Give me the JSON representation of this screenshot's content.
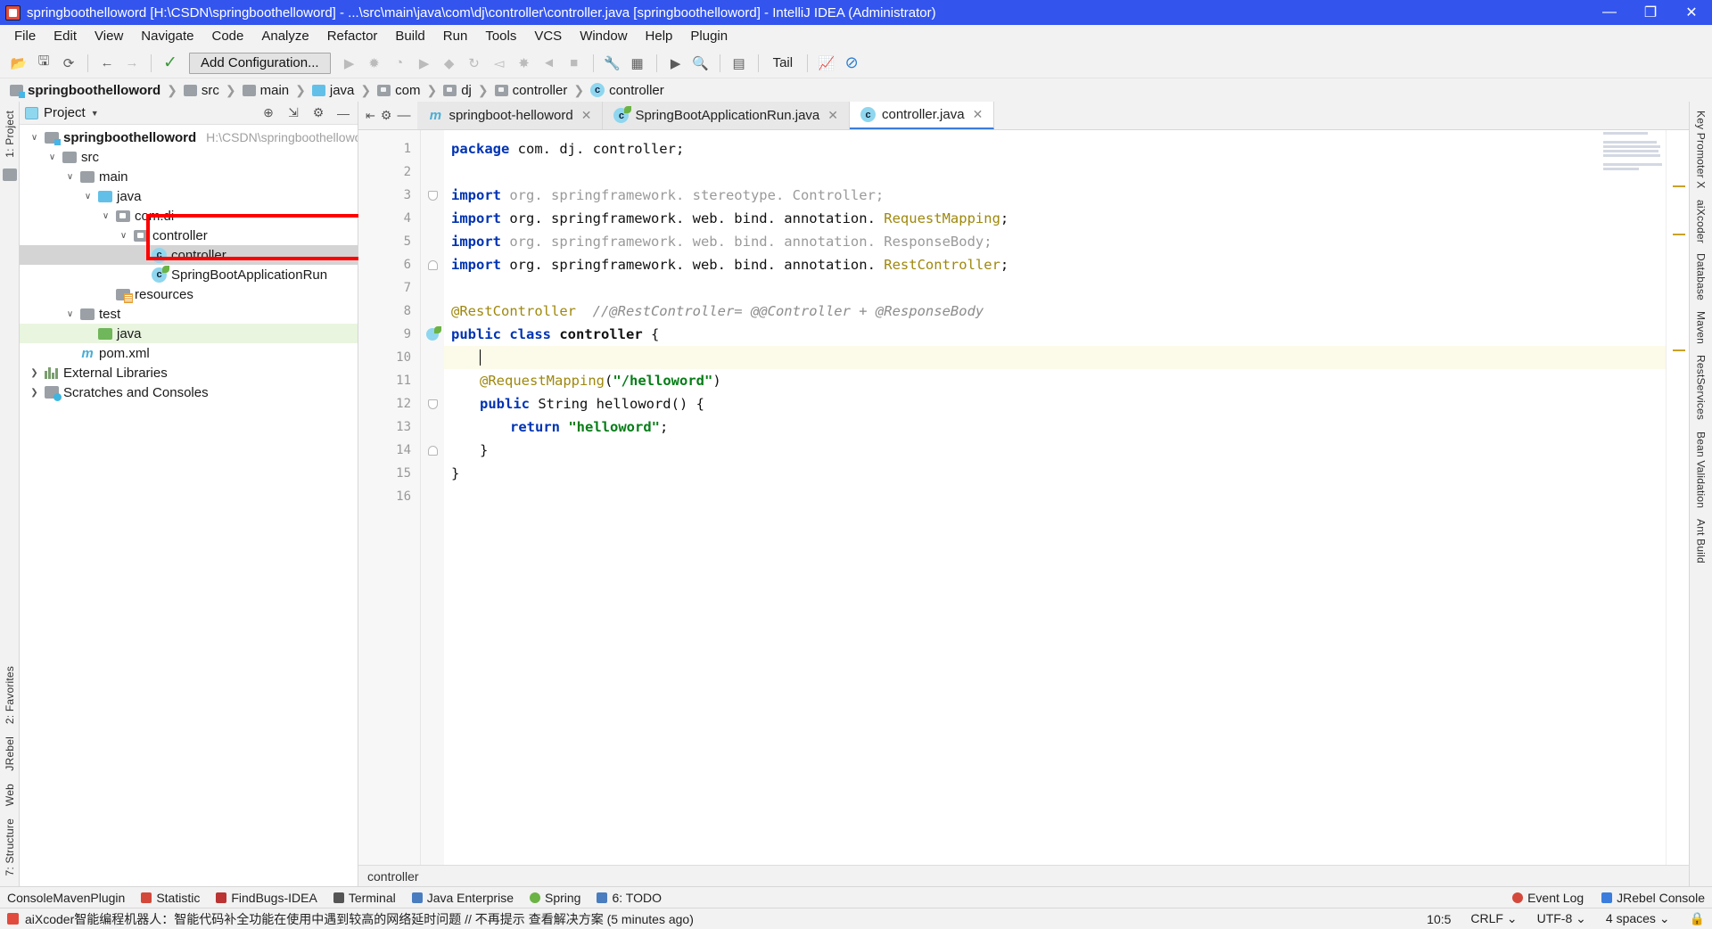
{
  "window": {
    "title": "springboothelloword [H:\\CSDN\\springboothelloword] - ...\\src\\main\\java\\com\\dj\\controller\\controller.java [springboothelloword] - IntelliJ IDEA (Administrator)",
    "minimize": "—",
    "maximize": "❐",
    "close": "✕"
  },
  "menu": [
    "File",
    "Edit",
    "View",
    "Navigate",
    "Code",
    "Analyze",
    "Refactor",
    "Build",
    "Run",
    "Tools",
    "VCS",
    "Window",
    "Help",
    "Plugin"
  ],
  "toolbar": {
    "open_icon": "open-folder-icon",
    "save_icon": "save-icon",
    "sync_icon": "sync-icon",
    "back_icon": "back-arrow-icon",
    "forward_icon": "forward-arrow-icon",
    "hammer_icon": "build-icon",
    "add_configuration": "Add Configuration...",
    "run_icon": "run-icon",
    "debug_icon": "debug-icon",
    "coverage_icon": "coverage-icon",
    "run2_icon": "run-alt-icon",
    "profile_icon": "profile-icon",
    "rerun_icon": "rerun-icon",
    "jrebel_run_icon": "jrebel-run-icon",
    "jrebel_debug_icon": "jrebel-debug-icon",
    "jrebel_icon": "jrebel-icon",
    "stop_icon": "stop-icon",
    "settings_icon": "wrench-icon",
    "project_structure_icon": "project-structure-icon",
    "terminal_icon": "terminal-icon",
    "search_icon": "search-icon",
    "db_icon": "database-save-icon",
    "tail_label": "Tail",
    "monitor_icon": "monitor-icon",
    "block_icon": "block-icon"
  },
  "breadcrumb": [
    {
      "label": "springboothelloword",
      "icon": "module-folder-icon",
      "bold": true
    },
    {
      "label": "src",
      "icon": "folder-icon",
      "bold": false
    },
    {
      "label": "main",
      "icon": "folder-icon",
      "bold": false
    },
    {
      "label": "java",
      "icon": "source-folder-icon",
      "bold": false
    },
    {
      "label": "com",
      "icon": "package-icon",
      "bold": false
    },
    {
      "label": "dj",
      "icon": "package-icon",
      "bold": false
    },
    {
      "label": "controller",
      "icon": "package-icon",
      "bold": false
    },
    {
      "label": "controller",
      "icon": "class-icon",
      "bold": false
    }
  ],
  "left_rail": {
    "project_tab": "1: Project",
    "favorites_tab": "2: Favorites",
    "structure_tab": "7: Structure",
    "jrebel_tab": "JRebel",
    "web_tab": "Web"
  },
  "right_rail": {
    "key_promoter": "Key Promoter X",
    "aixcoder": "aiXcoder",
    "database": "Database",
    "maven": "Maven",
    "rest_services": "RestServices",
    "bean_validation": "Bean Validation",
    "ant_build": "Ant Build"
  },
  "project_panel": {
    "title": "Project",
    "locate_icon": "locate-icon",
    "collapse_icon": "collapse-all-icon",
    "settings_icon": "gear-icon",
    "hide_icon": "hide-icon",
    "tree": [
      {
        "label": "springboothelloword",
        "path": "H:\\CSDN\\springboothelloword",
        "indent": 0,
        "arrow": "v",
        "icon": "module-folder-icon",
        "bold": true,
        "state": "normal"
      },
      {
        "label": "src",
        "path": "",
        "indent": 1,
        "arrow": "v",
        "icon": "folder-icon",
        "bold": false,
        "state": "normal"
      },
      {
        "label": "main",
        "path": "",
        "indent": 2,
        "arrow": "v",
        "icon": "folder-icon",
        "bold": false,
        "state": "normal"
      },
      {
        "label": "java",
        "path": "",
        "indent": 3,
        "arrow": "v",
        "icon": "source-folder-icon",
        "bold": false,
        "state": "normal"
      },
      {
        "label": "com.di",
        "path": "",
        "indent": 4,
        "arrow": "v",
        "icon": "package-icon",
        "bold": false,
        "state": "normal"
      },
      {
        "label": "controller",
        "path": "",
        "indent": 5,
        "arrow": "v",
        "icon": "package-icon",
        "bold": false,
        "state": "normal"
      },
      {
        "label": "controller",
        "path": "",
        "indent": 6,
        "arrow": "",
        "icon": "class-icon",
        "bold": false,
        "state": "selected"
      },
      {
        "label": "SpringBootApplicationRun",
        "path": "",
        "indent": 6,
        "arrow": "",
        "icon": "spring-class-icon",
        "bold": false,
        "state": "normal"
      },
      {
        "label": "resources",
        "path": "",
        "indent": 4,
        "arrow": "",
        "icon": "resources-folder-icon",
        "bold": false,
        "state": "normal"
      },
      {
        "label": "test",
        "path": "",
        "indent": 2,
        "arrow": "v",
        "icon": "folder-icon",
        "bold": false,
        "state": "normal"
      },
      {
        "label": "java",
        "path": "",
        "indent": 3,
        "arrow": "",
        "icon": "test-source-folder-icon",
        "bold": false,
        "state": "green"
      },
      {
        "label": "pom.xml",
        "path": "",
        "indent": 1,
        "arrow": "",
        "icon": "maven-icon",
        "bold": false,
        "state": "normal"
      },
      {
        "label": "External Libraries",
        "path": "",
        "indent": 0,
        "arrow": ">",
        "icon": "libraries-icon",
        "bold": false,
        "state": "normal"
      },
      {
        "label": "Scratches and Consoles",
        "path": "",
        "indent": 0,
        "arrow": ">",
        "icon": "scratches-icon",
        "bold": false,
        "state": "normal"
      }
    ]
  },
  "editor": {
    "tabs": [
      {
        "label": "springboot-helloword",
        "icon": "maven-icon",
        "active": false,
        "close": "✕"
      },
      {
        "label": "SpringBootApplicationRun.java",
        "icon": "spring-class-icon",
        "active": false,
        "close": "✕"
      },
      {
        "label": "controller.java",
        "icon": "class-icon",
        "active": true,
        "close": "✕"
      }
    ],
    "footer_breadcrumb": "controller",
    "lines": [
      {
        "n": 1,
        "current": false
      },
      {
        "n": 2,
        "current": false
      },
      {
        "n": 3,
        "current": false
      },
      {
        "n": 4,
        "current": false
      },
      {
        "n": 5,
        "current": false
      },
      {
        "n": 6,
        "current": false
      },
      {
        "n": 7,
        "current": false
      },
      {
        "n": 8,
        "current": false
      },
      {
        "n": 9,
        "current": false
      },
      {
        "n": 10,
        "current": true
      },
      {
        "n": 11,
        "current": false
      },
      {
        "n": 12,
        "current": false
      },
      {
        "n": 13,
        "current": false
      },
      {
        "n": 14,
        "current": false
      },
      {
        "n": 15,
        "current": false
      },
      {
        "n": 16,
        "current": false
      }
    ],
    "code": {
      "l1_kw": "package",
      "l1_rest": " com. dj. controller;",
      "l3_kw": "import",
      "l3_rest": " org. springframework. stereotype. Controller;",
      "l4_kw": "import",
      "l4_mid": " org. springframework. web. bind. annotation. ",
      "l4_type": "RequestMapping",
      "l4_end": ";",
      "l5_kw": "import",
      "l5_rest": " org. springframework. web. bind. annotation. ResponseBody;",
      "l6_kw": "import",
      "l6_mid": " org. springframework. web. bind. annotation. ",
      "l6_type": "RestController",
      "l6_end": ";",
      "l8_ann": "@RestController",
      "l8_comment": "  //@RestController= @@Controller + @ResponseBody",
      "l9_kw1": "public",
      "l9_kw2": "class",
      "l9_name": " controller ",
      "l9_brace": "{",
      "l11_ann": "@RequestMapping",
      "l11_open": "(",
      "l11_str": "\"/helloword\"",
      "l11_close": ")",
      "l12_kw1": "public",
      "l12_type": " String ",
      "l12_name": "helloword",
      "l12_rest": "() {",
      "l13_kw": "return",
      "l13_str": " \"helloword\"",
      "l13_end": ";",
      "l14_brace": "}",
      "l15_brace": "}"
    }
  },
  "tool_windows": {
    "left": [
      {
        "label": "ConsoleMavenPlugin",
        "icon": ""
      },
      {
        "label": "Statistic",
        "icon": "statistic-icon"
      },
      {
        "label": "FindBugs-IDEA",
        "icon": "findbugs-icon"
      },
      {
        "label": "Terminal",
        "icon": "terminal-icon"
      },
      {
        "label": "Java Enterprise",
        "icon": "java-enterprise-icon"
      },
      {
        "label": "Spring",
        "icon": "spring-icon"
      },
      {
        "label": "6: TODO",
        "icon": "todo-icon"
      }
    ],
    "right": [
      {
        "label": "Event Log",
        "icon": "event-log-icon"
      },
      {
        "label": "JRebel Console",
        "icon": "jrebel-icon"
      }
    ]
  },
  "status_bar": {
    "message": "aiXcoder智能编程机器人：智能代码补全功能在使用中遇到较高的网络延时问题 // 不再提示 查看解决方案 (5 minutes ago)",
    "caret_position": "10:5",
    "line_separator": "CRLF",
    "encoding": "UTF-8",
    "indent": "4 spaces",
    "lock_icon": "lock-icon"
  },
  "colors": {
    "title_bar": "#3355ee",
    "accent_blue": "#3b7ddd",
    "annotation_red": "#ff0000",
    "keyword": "#0033b3",
    "string": "#067d17",
    "annotation_yellow": "#9e880d",
    "comment": "#8c8c8c",
    "current_line": "#fcfae8",
    "selection": "#d4d4d4"
  }
}
